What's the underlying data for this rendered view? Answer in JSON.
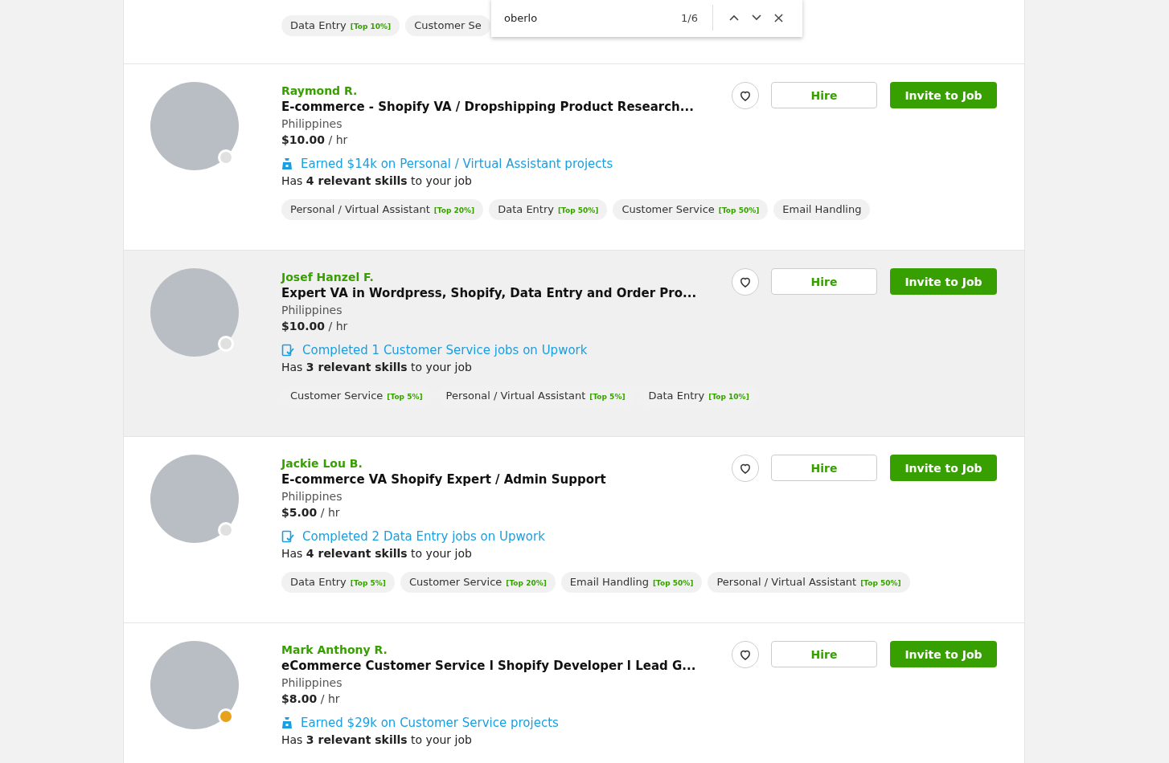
{
  "find_bar": {
    "query": "oberlo",
    "count": "1/6"
  },
  "partial_card": {
    "tags": [
      {
        "label": "Data Entry",
        "rank": "[Top 10%]"
      },
      {
        "label": "Customer Se"
      }
    ]
  },
  "freelancers": [
    {
      "name": "Raymond R.",
      "title": "E-commerce - Shopify VA / Dropshipping Product Research...",
      "location": "Philippines",
      "rate": "$10.00",
      "rate_unit": "/ hr",
      "color": "#e0e0e0",
      "highlighted": false,
      "history": {
        "kind": "earned",
        "text": "Earned $14k on Personal / Virtual Assistant projects"
      },
      "skills_line": "Has **4 relevant skills** to your job",
      "tags": [
        {
          "label": "Personal / Virtual Assistant",
          "rank": "[Top 20%]"
        },
        {
          "label": "Data Entry",
          "rank": "[Top 50%]"
        },
        {
          "label": "Customer Service",
          "rank": "[Top 50%]"
        },
        {
          "label": "Email Handling"
        }
      ],
      "hire": "Hire",
      "invite": "Invite to Job"
    },
    {
      "name": "Josef Hanzel F.",
      "title": "Expert VA in Wordpress, Shopify, Data Entry and Order Pro...",
      "location": "Philippines",
      "rate": "$10.00",
      "rate_unit": "/ hr",
      "color": "#e0e0e0",
      "highlighted": true,
      "history": {
        "kind": "completed",
        "text": "Completed 1 Customer Service jobs on Upwork"
      },
      "skills_line": "Has **3 relevant skills** to your job",
      "tags": [
        {
          "label": "Customer Service",
          "rank": "[Top 5%]"
        },
        {
          "label": "Personal / Virtual Assistant",
          "rank": "[Top 5%]"
        },
        {
          "label": "Data Entry",
          "rank": "[Top 10%]"
        }
      ],
      "hire": "Hire",
      "invite": "Invite to Job"
    },
    {
      "name": "Jackie Lou B.",
      "title": "E-commerce VA Shopify Expert / Admin Support",
      "location": "Philippines",
      "rate": "$5.00",
      "rate_unit": "/ hr",
      "color": "#e0e0e0",
      "highlighted": false,
      "history": {
        "kind": "completed",
        "text": "Completed 2 Data Entry jobs on Upwork"
      },
      "skills_line": "Has **4 relevant skills** to your job",
      "tags": [
        {
          "label": "Data Entry",
          "rank": "[Top 5%]"
        },
        {
          "label": "Customer Service",
          "rank": "[Top 20%]"
        },
        {
          "label": "Email Handling",
          "rank": "[Top 50%]"
        },
        {
          "label": "Personal / Virtual Assistant",
          "rank": "[Top 50%]"
        }
      ],
      "hire": "Hire",
      "invite": "Invite to Job"
    },
    {
      "name": "Mark Anthony R.",
      "title": "eCommerce Customer Service l Shopify Developer l Lead G...",
      "location": "Philippines",
      "rate": "$8.00",
      "rate_unit": "/ hr",
      "color": "#e8a11c",
      "highlighted": false,
      "history": {
        "kind": "earned",
        "text": "Earned $29k on Customer Service projects"
      },
      "skills_line": "Has **3 relevant skills** to your job",
      "hire": "Hire",
      "invite": "Invite to Job"
    }
  ]
}
